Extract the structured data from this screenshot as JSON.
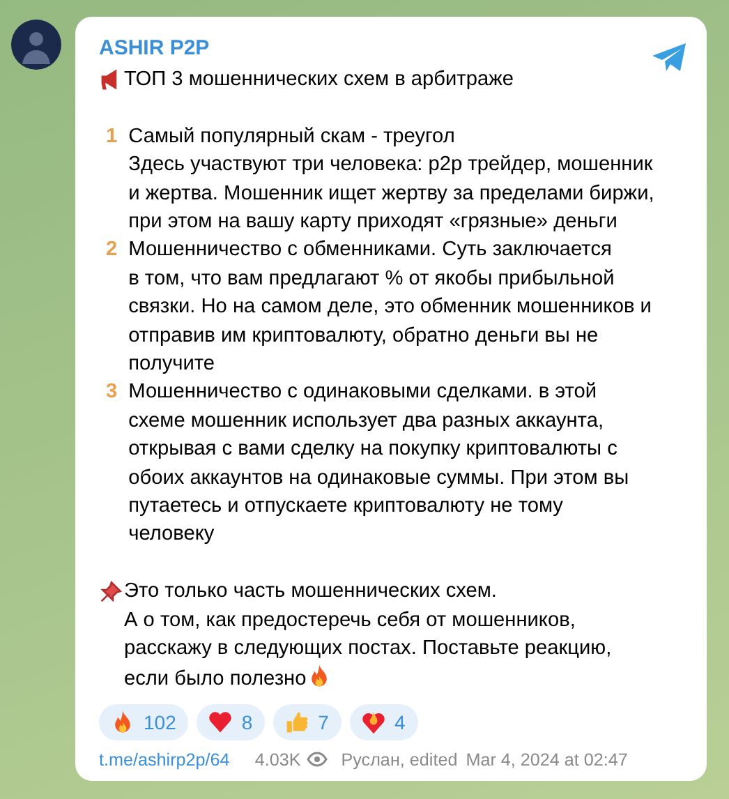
{
  "channel": {
    "name": "ASHIR P2P"
  },
  "blocks": [
    {
      "kind": "headline",
      "lines": [
        "ТОП 3 мошеннических схем в арбитраже"
      ]
    },
    {
      "kind": "blank"
    },
    {
      "kind": "numbered",
      "number": "1",
      "lines": [
        "Самый популярный скам - треугол",
        "Здесь участвуют три человека: p2p трейдер, мошенник",
        "и жертва. Мошенник ищет жертву за пределами биржи,",
        "при этом на вашу карту приходят «грязные» деньги"
      ]
    },
    {
      "kind": "numbered",
      "number": "2",
      "lines": [
        "Мошенничество с обменниками. Суть заключается",
        "в том, что вам предлагают % от якобы прибыльной",
        "связки. Но на самом деле, это обменник мошенников и",
        "отправив им криптовалюту, обратно деньги вы не",
        "получите"
      ]
    },
    {
      "kind": "numbered",
      "number": "3",
      "lines": [
        "Мошенничество с одинаковыми сделками. в этой",
        "схеме мошенник использует два разных аккаунта,",
        "открывая с вами сделку на покупку криптовалюты с",
        "обоих аккаунтов на одинаковые суммы. При этом вы",
        "путаетесь и отпускаете криптовалюту не тому",
        "человеку"
      ]
    },
    {
      "kind": "blank"
    },
    {
      "kind": "pinned",
      "lines": [
        "Это только часть мошеннических схем.",
        "А о том, как предостеречь себя от мошенников,",
        "расскажу в следующих постах. Поставьте реакцию,",
        "если было полезно"
      ]
    }
  ],
  "reactions": [
    {
      "kind": "fire",
      "count": "102"
    },
    {
      "kind": "heart",
      "count": "8"
    },
    {
      "kind": "thumbs_up",
      "count": "7"
    },
    {
      "kind": "heart_on_fire",
      "count": "4"
    }
  ],
  "footer": {
    "link": "t.me/ashirp2p/64",
    "views": "4.03K",
    "author": "Руслан, edited",
    "date": "Mar 4, 2024 at 02:47"
  }
}
